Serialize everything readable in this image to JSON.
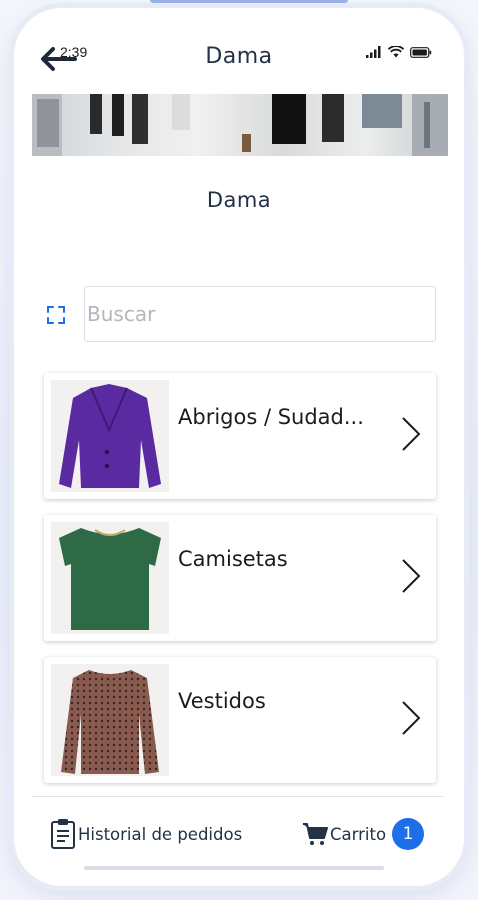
{
  "status_bar": {
    "time": "2:39"
  },
  "header": {
    "title": "Dama"
  },
  "page": {
    "subtitle": "Dama"
  },
  "search": {
    "placeholder": "Buscar",
    "value": ""
  },
  "categories": [
    {
      "label": "Abrigos / Sudad...",
      "thumb_icon": "purple-coat-image"
    },
    {
      "label": "Camisetas",
      "thumb_icon": "green-tshirt-image"
    },
    {
      "label": "Vestidos",
      "thumb_icon": "patterned-dress-image"
    }
  ],
  "bottom_nav": {
    "history_label": "Historial de pedidos",
    "cart_label": "Carrito",
    "cart_count": "1"
  },
  "colors": {
    "accent": "#1c6fe8",
    "text_dark": "#233244",
    "coat": "#5a2aa0",
    "tshirt": "#2d6a45",
    "dress": "#8a5a4e"
  }
}
